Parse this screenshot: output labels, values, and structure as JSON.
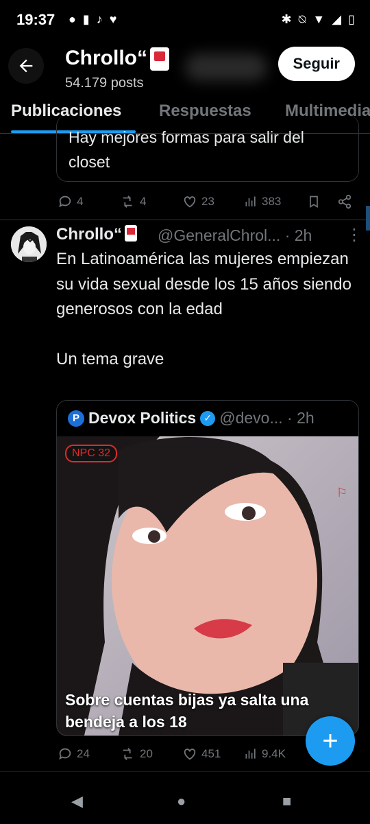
{
  "status_bar": {
    "time": "19:37",
    "left_icons": [
      "chat-bubble-icon",
      "battery-saver-icon",
      "tiktok-icon",
      "heart-icon"
    ],
    "right_icons": [
      "bluetooth-icon",
      "bell-off-icon",
      "wifi-icon",
      "signal-icon",
      "battery-icon"
    ]
  },
  "header": {
    "name": "Chrollo“",
    "posts": "54.179 posts",
    "follow_label": "Seguir"
  },
  "tabs": [
    {
      "label": "Publicaciones",
      "active": true
    },
    {
      "label": "Respuestas",
      "active": false
    },
    {
      "label": "Multimedia",
      "active": false
    }
  ],
  "prev_tweet": {
    "text": "Hay mejores formas para salir del closet",
    "replies": "4",
    "reposts": "4",
    "likes": "23",
    "views": "383"
  },
  "tweet": {
    "name": "Chrollo“",
    "handle": "@GeneralChrol... · 2h",
    "body": "En Latinoamérica las mujeres empiezan su vida sexual desde los 15 años siendo generosos con la edad\n\nUn tema grave",
    "quoted": {
      "logo_letter": "P",
      "name": "Devox Politics",
      "handle": "@devo... · 2h",
      "badge": "NPC  32",
      "caption": "Sobre cuentas bijas ya salta una bendeja a los 18"
    },
    "replies": "24",
    "reposts": "20",
    "likes": "451",
    "views": "9.4K"
  },
  "colors": {
    "accent": "#1d9bf0",
    "muted": "#71767b",
    "background": "#000000"
  }
}
